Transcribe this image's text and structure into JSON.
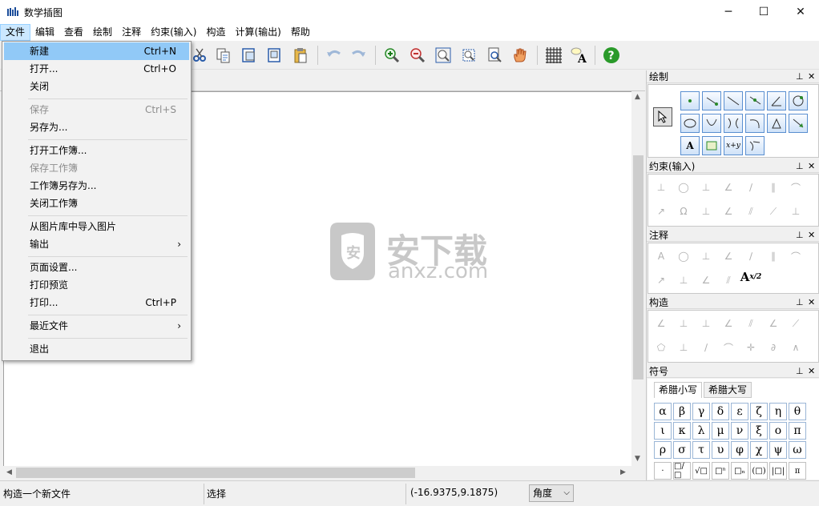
{
  "window": {
    "title": "数学插图",
    "minimize": "─",
    "maximize": "☐",
    "close": "✕"
  },
  "menubar": [
    "文件",
    "编辑",
    "查看",
    "绘制",
    "注释",
    "约束(输入)",
    "构造",
    "计算(输出)",
    "帮助"
  ],
  "file_menu": {
    "items": [
      {
        "label": "新建",
        "shortcut": "Ctrl+N",
        "state": "highlighted"
      },
      {
        "label": "打开...",
        "shortcut": "Ctrl+O"
      },
      {
        "label": "关闭",
        "shortcut": ""
      },
      {
        "label": "保存",
        "shortcut": "Ctrl+S",
        "state": "disabled"
      },
      {
        "label": "另存为...",
        "shortcut": ""
      },
      {
        "label": "打开工作簿...",
        "shortcut": ""
      },
      {
        "label": "保存工作簿",
        "shortcut": "",
        "state": "disabled"
      },
      {
        "label": "工作簿另存为...",
        "shortcut": ""
      },
      {
        "label": "关闭工作簿",
        "shortcut": ""
      },
      {
        "label": "从图片库中导入图片",
        "shortcut": ""
      },
      {
        "label": "输出",
        "shortcut": "",
        "submenu": "›"
      },
      {
        "label": "页面设置...",
        "shortcut": ""
      },
      {
        "label": "打印预览",
        "shortcut": ""
      },
      {
        "label": "打印...",
        "shortcut": "Ctrl+P"
      },
      {
        "label": "最近文件",
        "shortcut": "",
        "submenu": "›"
      },
      {
        "label": "退出",
        "shortcut": ""
      }
    ]
  },
  "toolbar_icons": [
    "cut-icon",
    "copy-icon",
    "copy-special-icon",
    "paste-special-icon",
    "paste-icon",
    "undo-icon",
    "redo-icon",
    "zoom-in-icon",
    "zoom-out-icon",
    "zoom-fit-icon",
    "zoom-page-icon",
    "zoom-region-icon",
    "pan-hand-icon",
    "grid-icon",
    "font-icon",
    "help-icon"
  ],
  "watermark": {
    "brand": "安下载",
    "url": "anxz.com"
  },
  "panels": {
    "draw": {
      "title": "绘制"
    },
    "constraint": {
      "title": "约束(输入)"
    },
    "annotation": {
      "title": "注释"
    },
    "construct": {
      "title": "构造"
    },
    "symbols": {
      "title": "符号",
      "tabs": [
        "希腊小写",
        "希腊大写"
      ],
      "greek": [
        "α",
        "β",
        "γ",
        "δ",
        "ε",
        "ζ",
        "η",
        "θ",
        "ι",
        "κ",
        "λ",
        "μ",
        "ν",
        "ξ",
        "ο",
        "π",
        "ρ",
        "σ",
        "τ",
        "υ",
        "φ",
        "χ",
        "ψ",
        "ω"
      ],
      "ops": [
        "·",
        "□/□",
        "√□",
        "□ⁿ",
        "□ₙ",
        "(□)",
        "|□|",
        "π"
      ]
    },
    "pin": "ᵖ",
    "close": "✕"
  },
  "status": {
    "message": "构造一个新文件",
    "mode": "选择",
    "coords": "(-16.9375,9.1875)",
    "angle": "角度"
  },
  "colors": {
    "highlight": "#91c9f7",
    "menu_active": "#cce8ff",
    "watermark": "#c8c8c8"
  }
}
